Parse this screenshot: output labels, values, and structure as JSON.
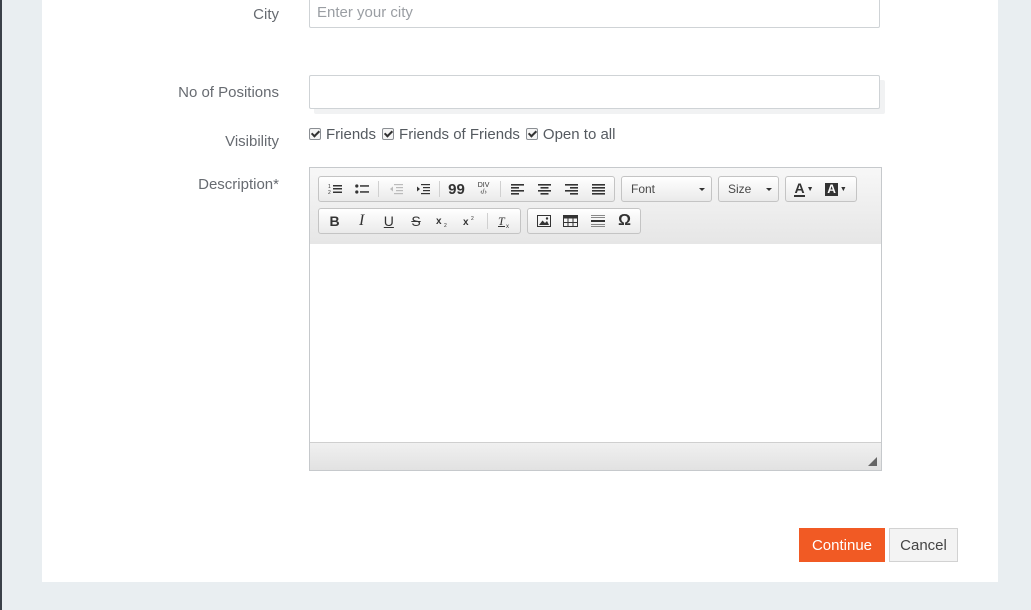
{
  "form": {
    "city": {
      "label": "City",
      "placeholder": "Enter your city",
      "value": ""
    },
    "positions": {
      "label": "No of Positions",
      "value": ""
    },
    "visibility": {
      "label": "Visibility",
      "options": [
        {
          "label": "Friends",
          "checked": true
        },
        {
          "label": "Friends of Friends",
          "checked": true
        },
        {
          "label": "Open to all",
          "checked": true
        }
      ]
    },
    "description": {
      "label": "Description*"
    }
  },
  "editor": {
    "font_combo": "Font",
    "size_combo": "Size",
    "icons": {
      "numbered_list": "numbered-list-icon",
      "bulleted_list": "bulleted-list-icon",
      "decrease_indent": "decrease-indent-icon",
      "increase_indent": "increase-indent-icon",
      "blockquote": "blockquote-icon",
      "div": "div-container-icon",
      "align_left": "align-left-icon",
      "align_center": "align-center-icon",
      "align_right": "align-right-icon",
      "justify": "justify-icon",
      "text_color": "text-color-icon",
      "bg_color": "background-color-icon",
      "bold": "bold-icon",
      "italic": "italic-icon",
      "underline": "underline-icon",
      "strike": "strikethrough-icon",
      "subscript": "subscript-icon",
      "superscript": "superscript-icon",
      "remove_format": "remove-format-icon",
      "image": "image-icon",
      "table": "table-icon",
      "hr": "horizontal-line-icon",
      "special_char": "special-character-icon"
    },
    "glyphs": {
      "bold": "B",
      "italic": "I",
      "underline": "U",
      "strike": "S",
      "omega": "Ω",
      "quote": "99",
      "div": "DIV",
      "text_color": "A",
      "bg_color": "A"
    }
  },
  "actions": {
    "continue": "Continue",
    "cancel": "Cancel"
  },
  "colors": {
    "accent": "#f15a24",
    "page_bg": "#e9eef1"
  }
}
